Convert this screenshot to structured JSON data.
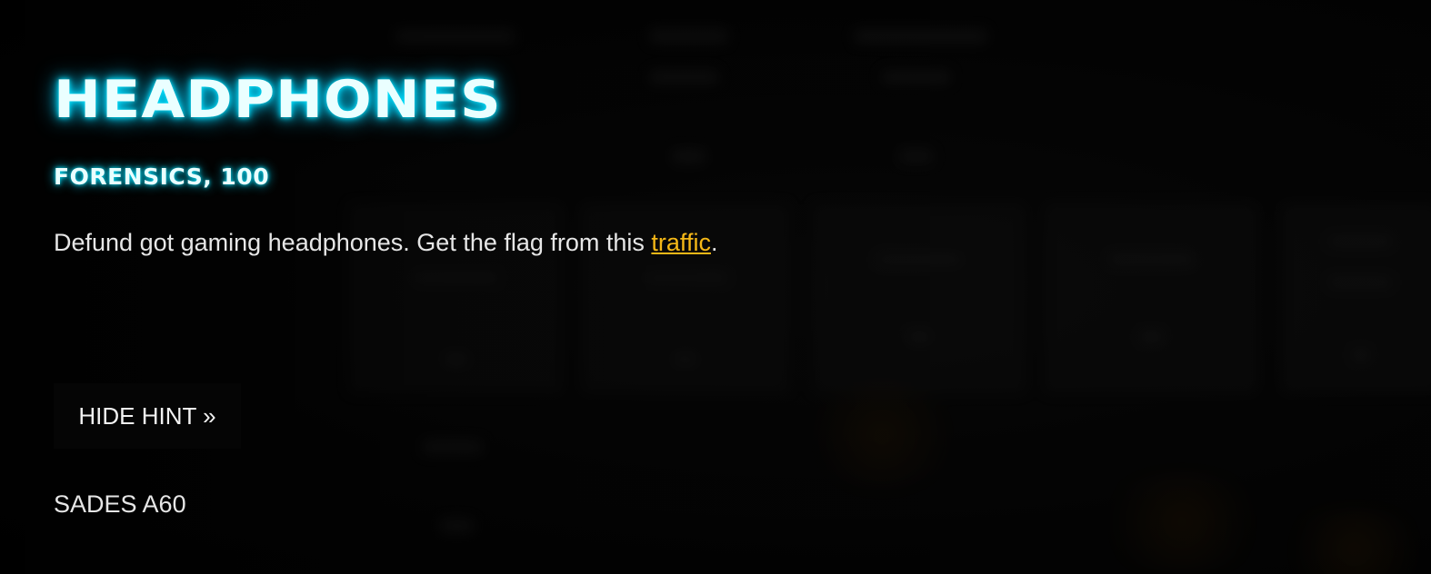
{
  "challenge": {
    "title": "HEADPHONES",
    "subtitle": "FORENSICS, 100",
    "description_before": "Defund got gaming headphones. Get the flag from this ",
    "description_link": "traffic",
    "description_after": ".",
    "hint_button": "HIDE HINT »",
    "hint_text": "SADES A60"
  },
  "colors": {
    "title_glow": "#00e5ff",
    "link": "#f5b817",
    "background": "#050505"
  }
}
